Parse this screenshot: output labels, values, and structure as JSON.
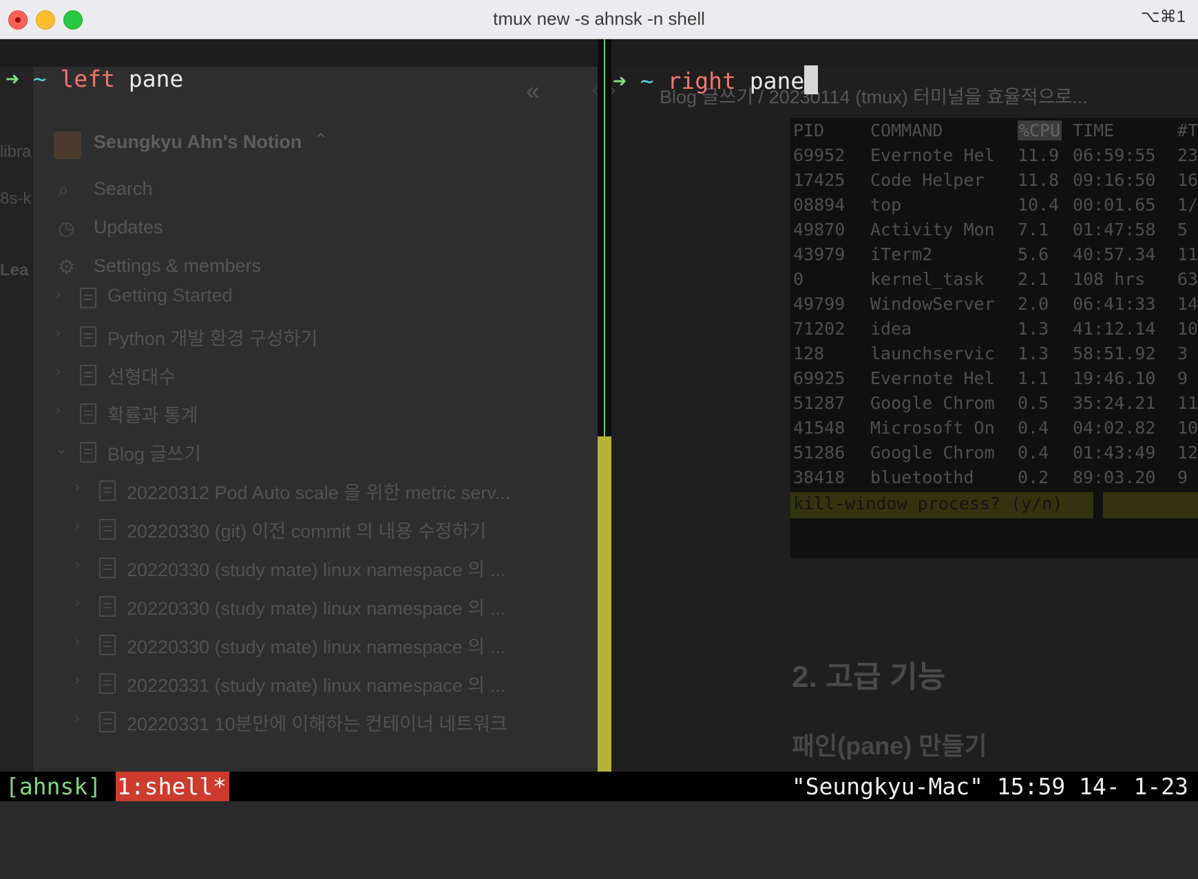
{
  "window": {
    "title": "tmux new -s ahnsk -n shell",
    "shortcut": "⌥⌘1"
  },
  "left_pane": {
    "arrow": "➜",
    "tilde": "~",
    "cmd": "left",
    "arg": "pane"
  },
  "right_pane": {
    "arrow": "➜",
    "tilde": "~",
    "cmd": "right",
    "arg": "pane"
  },
  "background": {
    "workspace_name": "Seungkyu Ahn's Notion",
    "nav": [
      "Search",
      "Updates",
      "Settings & members"
    ],
    "left_cutoff": [
      "libra",
      "8s-k",
      "Lea"
    ],
    "pages": [
      "Getting Started",
      "Python 개발 환경 구성하기",
      "선형대수",
      "확률과 통계",
      "Blog 글쓰기",
      "20220312 Pod Auto scale 을 위한 metric serv...",
      "20220330 (git) 이전 commit 의 내용 수정하기",
      "20220330 (study mate) linux namespace 의 ...",
      "20220330 (study mate) linux namespace 의 ...",
      "20220330 (study mate) linux namespace 의 ...",
      "20220331 (study mate) linux namespace 의 ...",
      "20220331 10분만에 이해하는 컨테이너 네트워크"
    ],
    "breadcrumb": "Blog 글쓰기 / 20230114 (tmux) 터미널을 효율적으로...",
    "heading2": "2. 고급 기능",
    "heading3": "패인(pane) 만들기"
  },
  "top": {
    "headers": [
      "PID",
      "COMMAND",
      "%CPU",
      "TIME",
      "#T"
    ],
    "rows": [
      [
        "69952",
        "Evernote Hel",
        "11.9",
        "06:59:55",
        "23"
      ],
      [
        "17425",
        "Code Helper",
        "11.8",
        "09:16:50",
        "16"
      ],
      [
        "08894",
        "top",
        "10.4",
        "00:01.65",
        "1/"
      ],
      [
        "49870",
        "Activity Mon",
        "7.1",
        "01:47:58",
        "5"
      ],
      [
        "43979",
        "iTerm2",
        "5.6",
        "40:57.34",
        "11"
      ],
      [
        "0",
        "kernel_task",
        "2.1",
        "108 hrs",
        "63"
      ],
      [
        "49799",
        "WindowServer",
        "2.0",
        "06:41:33",
        "14"
      ],
      [
        "71202",
        "idea",
        "1.3",
        "41:12.14",
        "10"
      ],
      [
        "128",
        "launchservic",
        "1.3",
        "58:51.92",
        "3"
      ],
      [
        "69925",
        "Evernote Hel",
        "1.1",
        "19:46.10",
        "9"
      ],
      [
        "51287",
        "Google Chrom",
        "0.5",
        "35:24.21",
        "11"
      ],
      [
        "41548",
        "Microsoft On",
        "0.4",
        "04:02.82",
        "10"
      ],
      [
        "51286",
        "Google Chrom",
        "0.4",
        "01:43:49",
        "12"
      ],
      [
        "38418",
        "bluetoothd",
        "0.2",
        "89:03.20",
        "9"
      ]
    ],
    "prompt": "kill-window process? (y/n)"
  },
  "status_bar": {
    "session": "[ahnsk]",
    "window": "1:shell*",
    "right": "\"Seungkyu-Mac\" 15:59 14- 1-23"
  }
}
